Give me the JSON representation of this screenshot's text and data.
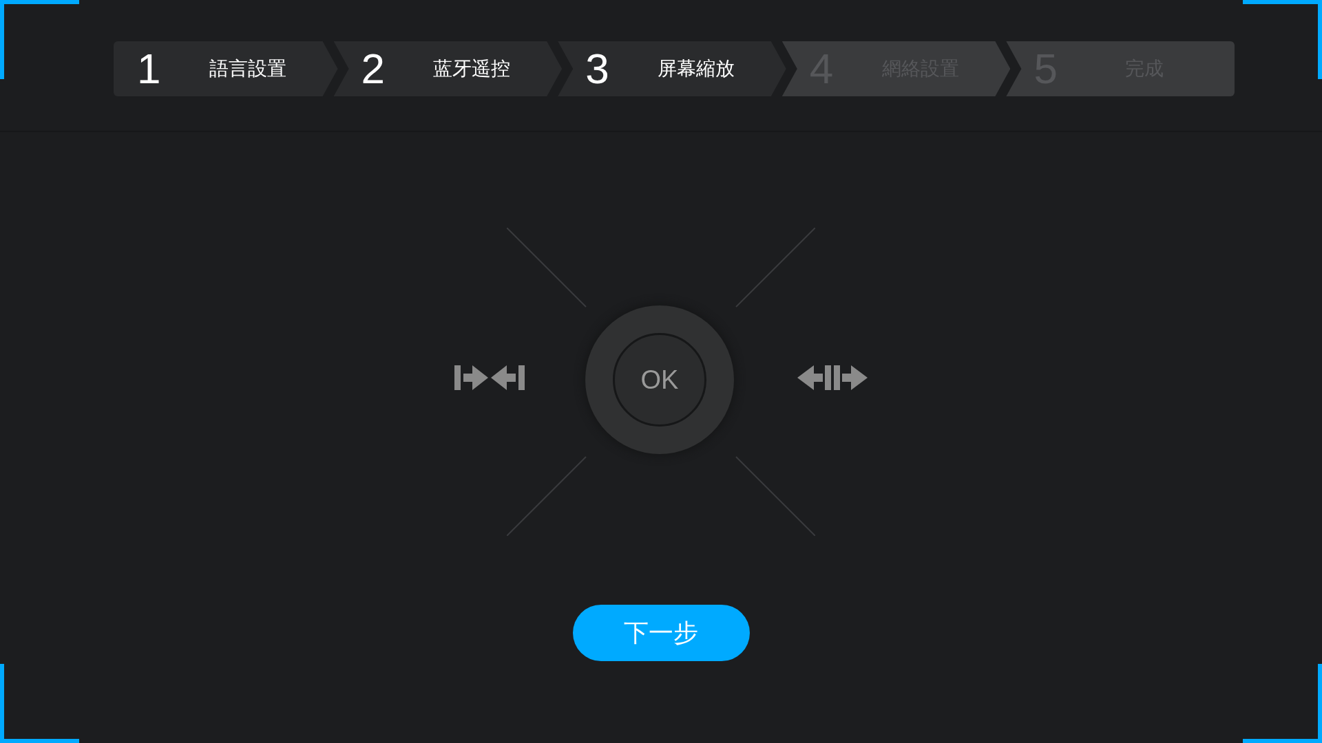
{
  "steps": [
    {
      "number": "1",
      "label": "語言設置",
      "done": true
    },
    {
      "number": "2",
      "label": "蓝牙遥控",
      "done": true
    },
    {
      "number": "3",
      "label": "屏幕縮放",
      "done": true
    },
    {
      "number": "4",
      "label": "網絡設置",
      "done": false
    },
    {
      "number": "5",
      "label": "完成",
      "done": false
    }
  ],
  "dpad": {
    "center_label": "OK"
  },
  "next_button": "下一步"
}
